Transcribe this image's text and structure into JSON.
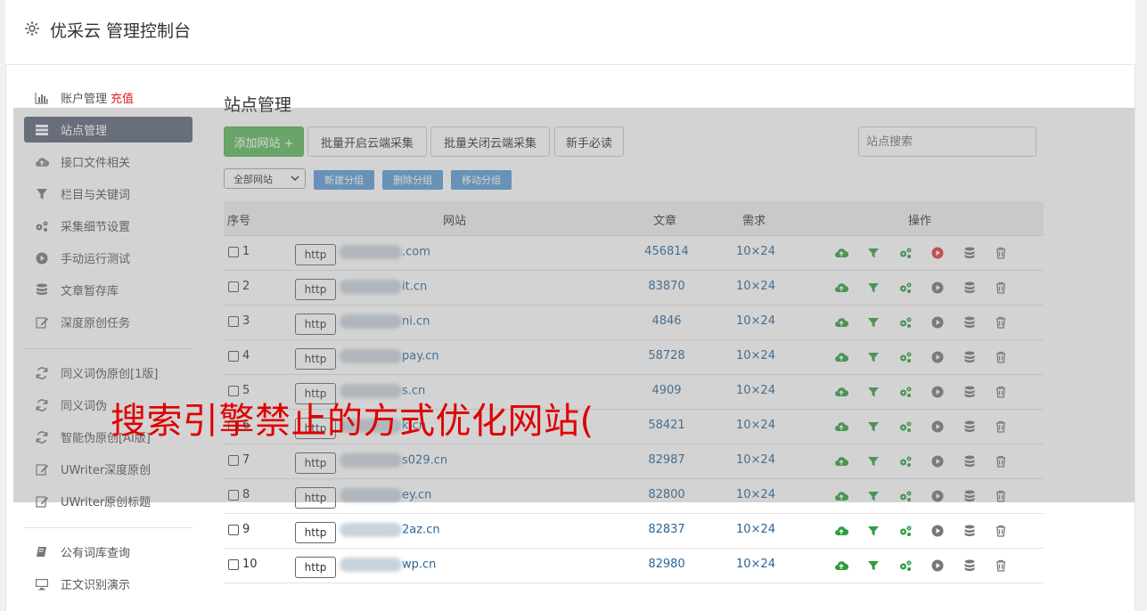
{
  "header": {
    "title": "优采云 管理控制台"
  },
  "sidebar": {
    "items": [
      {
        "label": "账户管理",
        "extra": "充值",
        "icon": "bar-chart-icon"
      },
      {
        "label": "站点管理",
        "icon": "server-icon"
      },
      {
        "label": "接口文件相关",
        "icon": "cloud-upload-icon"
      },
      {
        "label": "栏目与关键词",
        "icon": "filter-icon"
      },
      {
        "label": "采集细节设置",
        "icon": "gears-icon"
      },
      {
        "label": "手动运行测试",
        "icon": "play-circle-icon"
      },
      {
        "label": "文章暂存库",
        "icon": "database-icon"
      },
      {
        "label": "深度原创任务",
        "icon": "edit-icon"
      },
      {
        "label": "同义词伪原创[1版]",
        "icon": "refresh-icon"
      },
      {
        "label": "同义词伪",
        "icon": "refresh-icon"
      },
      {
        "label": "智能伪原创[AI版]",
        "icon": "refresh-icon"
      },
      {
        "label": "UWriter深度原创",
        "icon": "edit-icon"
      },
      {
        "label": "UWriter原创标题",
        "icon": "edit-icon"
      },
      {
        "label": "公有词库查询",
        "icon": "book-icon"
      },
      {
        "label": "正文识别演示",
        "icon": "monitor-icon"
      }
    ]
  },
  "main": {
    "title": "站点管理",
    "toolbar": {
      "add_site": "添加网站 +",
      "batch_on": "批量开启云端采集",
      "batch_off": "批量关闭云端采集",
      "beginner": "新手必读",
      "search_placeholder": "站点搜索"
    },
    "filter": {
      "group_select": "全部网站",
      "new_group": "新建分组",
      "delete_group": "删除分组",
      "move_group": "移动分组"
    },
    "table": {
      "headers": {
        "index": "序号",
        "site": "网站",
        "articles": "文章",
        "demand": "需求",
        "actions": "操作"
      },
      "rows": [
        {
          "num": "1",
          "proto": "http",
          "site": ".com",
          "articles": "456814",
          "demand": "10×24",
          "play_active": true
        },
        {
          "num": "2",
          "proto": "http",
          "site": "it.cn",
          "articles": "83870",
          "demand": "10×24",
          "play_active": false
        },
        {
          "num": "3",
          "proto": "http",
          "site": "ni.cn",
          "articles": "4846",
          "demand": "10×24",
          "play_active": false
        },
        {
          "num": "4",
          "proto": "http",
          "site": "pay.cn",
          "articles": "58728",
          "demand": "10×24",
          "play_active": false
        },
        {
          "num": "5",
          "proto": "http",
          "site": "s.cn",
          "articles": "4909",
          "demand": "10×24",
          "play_active": false
        },
        {
          "num": "6",
          "proto": "http",
          "site": "k.cn",
          "articles": "58421",
          "demand": "10×24",
          "play_active": false
        },
        {
          "num": "7",
          "proto": "http",
          "site": "s029.cn",
          "articles": "82987",
          "demand": "10×24",
          "play_active": false
        },
        {
          "num": "8",
          "proto": "http",
          "site": "ey.cn",
          "articles": "82800",
          "demand": "10×24",
          "play_active": false
        },
        {
          "num": "9",
          "proto": "http",
          "site": "2az.cn",
          "articles": "82837",
          "demand": "10×24",
          "play_active": false
        },
        {
          "num": "10",
          "proto": "http",
          "site": "wp.cn",
          "articles": "82980",
          "demand": "10×24",
          "play_active": false
        }
      ]
    }
  },
  "watermark": "搜索引擎禁止的方式优化网站(",
  "colors": {
    "green": "#2e9e3e",
    "active_sidebar": "#5b6577",
    "link": "#2a6496",
    "play_red": "#e03a3a",
    "watermark": "#e00000"
  }
}
